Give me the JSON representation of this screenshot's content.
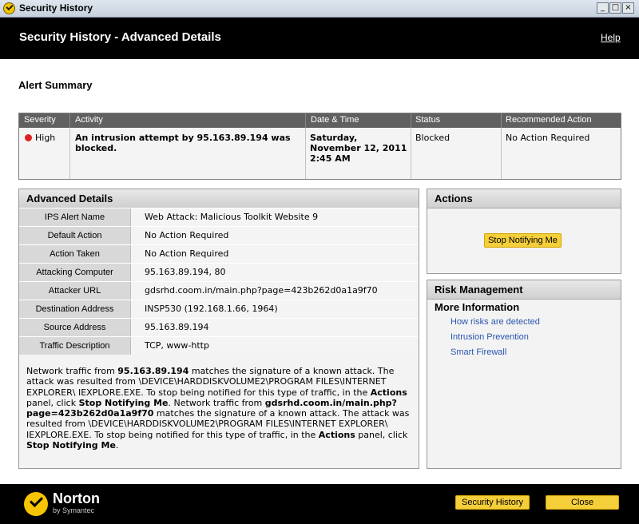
{
  "window": {
    "title": "Security History"
  },
  "header": {
    "title": "Security History - Advanced Details",
    "help": "Help"
  },
  "alert_summary": {
    "heading": "Alert Summary",
    "columns": [
      "Severity",
      "Activity",
      "Date & Time",
      "Status",
      "Recommended Action"
    ],
    "row": {
      "severity": "High",
      "activity_line1": "An intrusion attempt by 95.163.89.194 was",
      "activity_line2": "blocked.",
      "date_line1": "Saturday,",
      "date_line2": "November 12, 2011",
      "date_line3": "2:45 AM",
      "status": "Blocked",
      "recommended": "No Action Required"
    }
  },
  "advanced": {
    "heading": "Advanced Details",
    "rows": [
      {
        "label": "IPS Alert Name",
        "value": "Web Attack: Malicious Toolkit Website 9"
      },
      {
        "label": "Default Action",
        "value": "No Action Required"
      },
      {
        "label": "Action Taken",
        "value": "No Action Required"
      },
      {
        "label": "Attacking Computer",
        "value": "95.163.89.194, 80"
      },
      {
        "label": "Attacker URL",
        "value": "gdsrhd.coom.in/main.php?page=423b262d0a1a9f70"
      },
      {
        "label": "Destination Address",
        "value": "INSP530 (192.168.1.66, 1964)"
      },
      {
        "label": "Source Address",
        "value": "95.163.89.194"
      },
      {
        "label": "Traffic Description",
        "value": "TCP, www-http"
      }
    ],
    "description": {
      "t1": "Network traffic from ",
      "b1": "95.163.89.194",
      "t2": " matches the signature of a known attack. The attack was resulted from \\DEVICE\\HARDDISKVOLUME2\\PROGRAM FILES\\INTERNET EXPLORER\\ IEXPLORE.EXE. To stop being notified for this type of traffic, in the ",
      "b2": "Actions",
      "t3": " panel, click ",
      "b3": "Stop Notifying Me",
      "t4": ". Network traffic from ",
      "b4": "gdsrhd.coom.in/main.php?page=423b262d0a1a9f70",
      "t5": " matches the signature of a known attack. The attack was resulted from \\DEVICE\\HARDDISKVOLUME2\\PROGRAM FILES\\INTERNET EXPLORER\\ IEXPLORE.EXE. To stop being notified for this type of traffic, in the ",
      "b5": "Actions",
      "t6": " panel, click ",
      "b6": "Stop Notifying Me",
      "t7": "."
    }
  },
  "actions": {
    "heading": "Actions",
    "stop_label": "Stop Notifying Me"
  },
  "risk": {
    "heading": "Risk Management",
    "more_info": "More Information",
    "links": [
      "How risks are detected",
      "Intrusion Prevention",
      "Smart Firewall"
    ]
  },
  "footer": {
    "brand": "Norton",
    "brand_sub": "by Symantec",
    "security_history_label": "Security History",
    "close_label": "Close"
  },
  "colors": {
    "accent": "#f5cf3a",
    "link": "#2a55b0",
    "severity_high": "#e02020"
  }
}
